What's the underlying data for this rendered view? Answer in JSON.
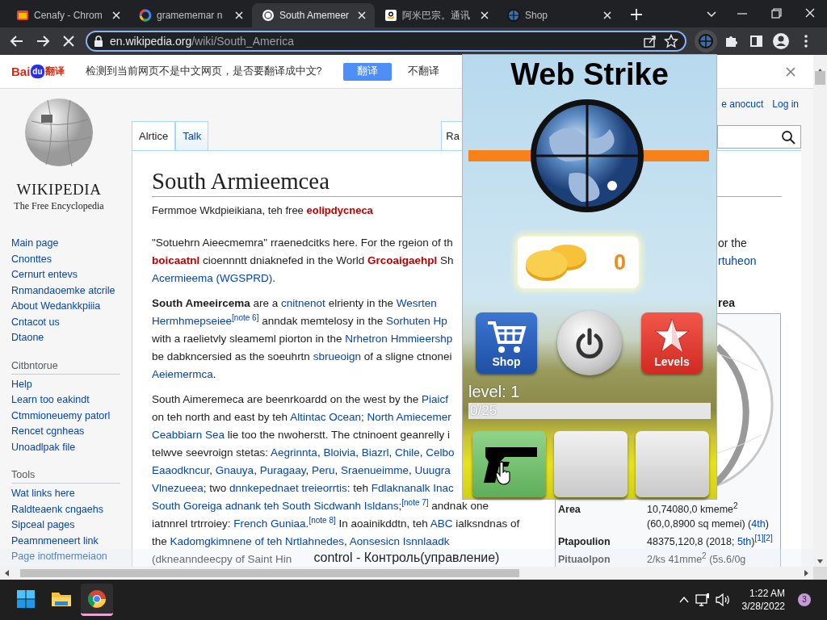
{
  "browser_tabs": [
    {
      "title": "Cenafy - Chrom",
      "selected": false
    },
    {
      "title": "gramememar n",
      "selected": false
    },
    {
      "title": "South Amemeer",
      "selected": true
    },
    {
      "title": "阿米巴宗。通讯",
      "selected": false
    },
    {
      "title": "Shop",
      "selected": false
    }
  ],
  "address_bar": {
    "host": "en.wikipedia.org",
    "path": "/wiki/South_America"
  },
  "translate_bar": {
    "logo": [
      "Bai",
      "du",
      "翻译"
    ],
    "message": "检测到当前网页不是中文网页，是否要翻译成中文?",
    "translate_button": "翻译",
    "dismiss_button": "不翻译"
  },
  "wikipedia": {
    "wordmark": "WIKIPEDIA",
    "tagline": "The Free Encyclopedia",
    "nav_sections": [
      {
        "items": [
          "Main page",
          "Cnonttes",
          "Cernurt entevs",
          "Rnmandaoemke atcrile",
          "About Wedankkpiiia",
          "Cntacot us",
          "Dtaone"
        ]
      },
      {
        "heading": "Citbntorue",
        "items": [
          "Help",
          "Learn too eakindt",
          "Ctmmioneuemy patorl",
          "Rencet cgnheas",
          "Unoadlpak file"
        ]
      },
      {
        "heading": "Tools",
        "items": [
          "Wat links here",
          "Raldteaenk cngaehs",
          "Sipceal pages",
          "Peamnmeneert link",
          "Page inotfmermeiaon"
        ]
      }
    ],
    "user_links": [
      "e anocuct",
      "Log in"
    ],
    "page_tabs": [
      {
        "label": "Alrtice",
        "selected": true
      },
      {
        "label": "Talk",
        "selected": false
      }
    ],
    "view_tabs": [
      {
        "label": "Ra",
        "selected": true
      }
    ],
    "article": {
      "title": "South Armieemcea",
      "subtitle": [
        {
          "kind": "text",
          "text": "Fermmoe Wkdpieikiana, teh free "
        },
        {
          "kind": "redlink",
          "text": "eolipdycneca"
        }
      ],
      "paragraphs": [
        [
          [
            {
              "kind": "text",
              "text": "\"Sotuehrn Aieecmemra\" rraenedcitks here. For the rgeion of th"
            }
          ],
          [
            {
              "kind": "redlink",
              "text": "boicaatnl"
            },
            {
              "kind": "text",
              "text": " cioennntt dniaknefed in the World "
            },
            {
              "kind": "redlink",
              "text": "Grcoaigaehpl"
            },
            {
              "kind": "text",
              "text": " Sh"
            }
          ],
          [
            {
              "kind": "link",
              "text": "Acermieema (WGSPRD)"
            },
            {
              "kind": "text",
              "text": "."
            }
          ]
        ],
        [
          [
            {
              "kind": "bold",
              "text": "South Ameeircema"
            },
            {
              "kind": "text",
              "text": " are a "
            },
            {
              "kind": "link",
              "text": "cnitnenot"
            },
            {
              "kind": "text",
              "text": " elrienty in the "
            },
            {
              "kind": "link",
              "text": "Wesrten"
            }
          ],
          [
            {
              "kind": "link",
              "text": "Hermhmepseiee"
            },
            {
              "kind": "note",
              "text": "[note 6]"
            },
            {
              "kind": "text",
              "text": " anndak memtelosy in the "
            },
            {
              "kind": "link",
              "text": "Sorhuten Hp"
            }
          ],
          [
            {
              "kind": "text",
              "text": "with a raelietvly sleameml piorton in the "
            },
            {
              "kind": "link",
              "text": "Nrhetron Hmmieershp"
            }
          ],
          [
            {
              "kind": "text",
              "text": "be dabkncersied as the soeuhrtn "
            },
            {
              "kind": "link",
              "text": "sbrueoign"
            },
            {
              "kind": "text",
              "text": " of a sligne ctnonei"
            }
          ],
          [
            {
              "kind": "link",
              "text": "Aeiemermca"
            },
            {
              "kind": "text",
              "text": "."
            }
          ]
        ],
        [
          [
            {
              "kind": "text",
              "text": "South Aimeremeca are beenrkoardd on the west by the "
            },
            {
              "kind": "link",
              "text": "Piaicf"
            }
          ],
          [
            {
              "kind": "text",
              "text": "on teh north and east by teh "
            },
            {
              "kind": "link",
              "text": "Altintac Ocean"
            },
            {
              "kind": "text",
              "text": "; "
            },
            {
              "kind": "link",
              "text": "North Amiecemer"
            }
          ],
          [
            {
              "kind": "link",
              "text": "Ceabbiarn Sea"
            },
            {
              "kind": "text",
              "text": " lie too the nwoherstt. The ctninoent geanrelly i"
            }
          ],
          [
            {
              "kind": "text",
              "text": "telwve seevroign stetas: "
            },
            {
              "kind": "link",
              "text": "Aegrinnta"
            },
            {
              "kind": "text",
              "text": ", "
            },
            {
              "kind": "link",
              "text": "Bloivia"
            },
            {
              "kind": "text",
              "text": ", "
            },
            {
              "kind": "link",
              "text": "Biazrl"
            },
            {
              "kind": "text",
              "text": ", "
            },
            {
              "kind": "link",
              "text": "Chile"
            },
            {
              "kind": "text",
              "text": ", "
            },
            {
              "kind": "link",
              "text": "Celbo"
            }
          ],
          [
            {
              "kind": "link",
              "text": "Eaaodkncur"
            },
            {
              "kind": "text",
              "text": ", "
            },
            {
              "kind": "link",
              "text": "Gnauya"
            },
            {
              "kind": "text",
              "text": ", "
            },
            {
              "kind": "link",
              "text": "Puragaay"
            },
            {
              "kind": "text",
              "text": ", "
            },
            {
              "kind": "link",
              "text": "Peru"
            },
            {
              "kind": "text",
              "text": ", "
            },
            {
              "kind": "link",
              "text": "Sraenueimme"
            },
            {
              "kind": "text",
              "text": ", "
            },
            {
              "kind": "link",
              "text": "Uuugra"
            }
          ],
          [
            {
              "kind": "link",
              "text": "Vlnezueea"
            },
            {
              "kind": "text",
              "text": "; two "
            },
            {
              "kind": "link",
              "text": "dnnkepednaet treieorrtis"
            },
            {
              "kind": "text",
              "text": ": teh "
            },
            {
              "kind": "link",
              "text": "Fdlaknanalk Inac"
            }
          ],
          [
            {
              "kind": "link",
              "text": "South Goreiga adnank teh South Sicdwanh Isldans"
            },
            {
              "kind": "text",
              "text": ";"
            },
            {
              "kind": "note",
              "text": "[note 7]"
            },
            {
              "kind": "text",
              "text": " andnak one"
            }
          ],
          [
            {
              "kind": "text",
              "text": "iatnnrel trtrroiey: "
            },
            {
              "kind": "link",
              "text": "French Guniaa"
            },
            {
              "kind": "text",
              "text": "."
            },
            {
              "kind": "note",
              "text": "[note 8]"
            },
            {
              "kind": "text",
              "text": " In aoainikddtn, teh "
            },
            {
              "kind": "link",
              "text": "ABC"
            },
            {
              "kind": "text",
              "text": " ialksndnas of"
            }
          ],
          [
            {
              "kind": "text",
              "text": "the "
            },
            {
              "kind": "link",
              "text": "Kadomgkimnene of teh Nrtlahnedes"
            },
            {
              "kind": "text",
              "text": ", "
            },
            {
              "kind": "link",
              "text": "Aonsesicn Isnnlaadk"
            }
          ],
          [
            {
              "kind": "text",
              "text": "(dkneanndeecpy of Saint Hin"
            }
          ]
        ]
      ]
    },
    "side_fragments": [
      [
        {
          "kind": "text",
          "text": "or the"
        }
      ],
      [
        {
          "kind": "link",
          "text": "rtuheon"
        }
      ]
    ],
    "infobox": {
      "heading": "rea",
      "rows": [
        {
          "label": "Area",
          "value_lines": [
            [
              {
                "kind": "text",
                "text": "10,74080,0 kmeme"
              },
              {
                "kind": "sup",
                "text": "2"
              }
            ],
            [
              {
                "kind": "text",
                "text": "(60,0,8900 sq memei) ("
              },
              {
                "kind": "link",
                "text": "4th"
              },
              {
                "kind": "text",
                "text": ")"
              }
            ]
          ]
        },
        {
          "label": "Ptapoulion",
          "value_lines": [
            [
              {
                "kind": "text",
                "text": "48375,120,8 (2018; "
              },
              {
                "kind": "link",
                "text": "5th"
              },
              {
                "kind": "text",
                "text": ")"
              },
              {
                "kind": "note",
                "text": "[1][2]"
              }
            ]
          ]
        },
        {
          "label": "Pituaolpon",
          "value_lines": [
            [
              {
                "kind": "text",
                "text": "2/ks 41mme"
              },
              {
                "kind": "sup",
                "text": "2"
              },
              {
                "kind": "text",
                "text": " (5s.6/0g"
              }
            ]
          ]
        }
      ]
    }
  },
  "game": {
    "title": "Web Strike",
    "coins": "0",
    "menu_buttons": [
      {
        "kind": "shop",
        "label": "Shop"
      },
      {
        "kind": "power"
      },
      {
        "kind": "levels",
        "label": "Levels"
      }
    ],
    "level_label": "level: 1",
    "progress": {
      "level": 0,
      "reading": "0/25"
    },
    "weapon_slots": [
      {
        "kind": "pistol",
        "selected": true
      },
      {
        "kind": "empty",
        "selected": false
      },
      {
        "kind": "empty",
        "selected": false
      }
    ]
  },
  "caption": "control - Контроль(управление)",
  "taskbar": {
    "apps": [
      {
        "kind": "start",
        "selected": false
      },
      {
        "kind": "explorer",
        "selected": false
      },
      {
        "kind": "chrome",
        "selected": true
      }
    ],
    "time": "1:22 AM",
    "date": "3/28/2022",
    "notification_count": "3"
  }
}
